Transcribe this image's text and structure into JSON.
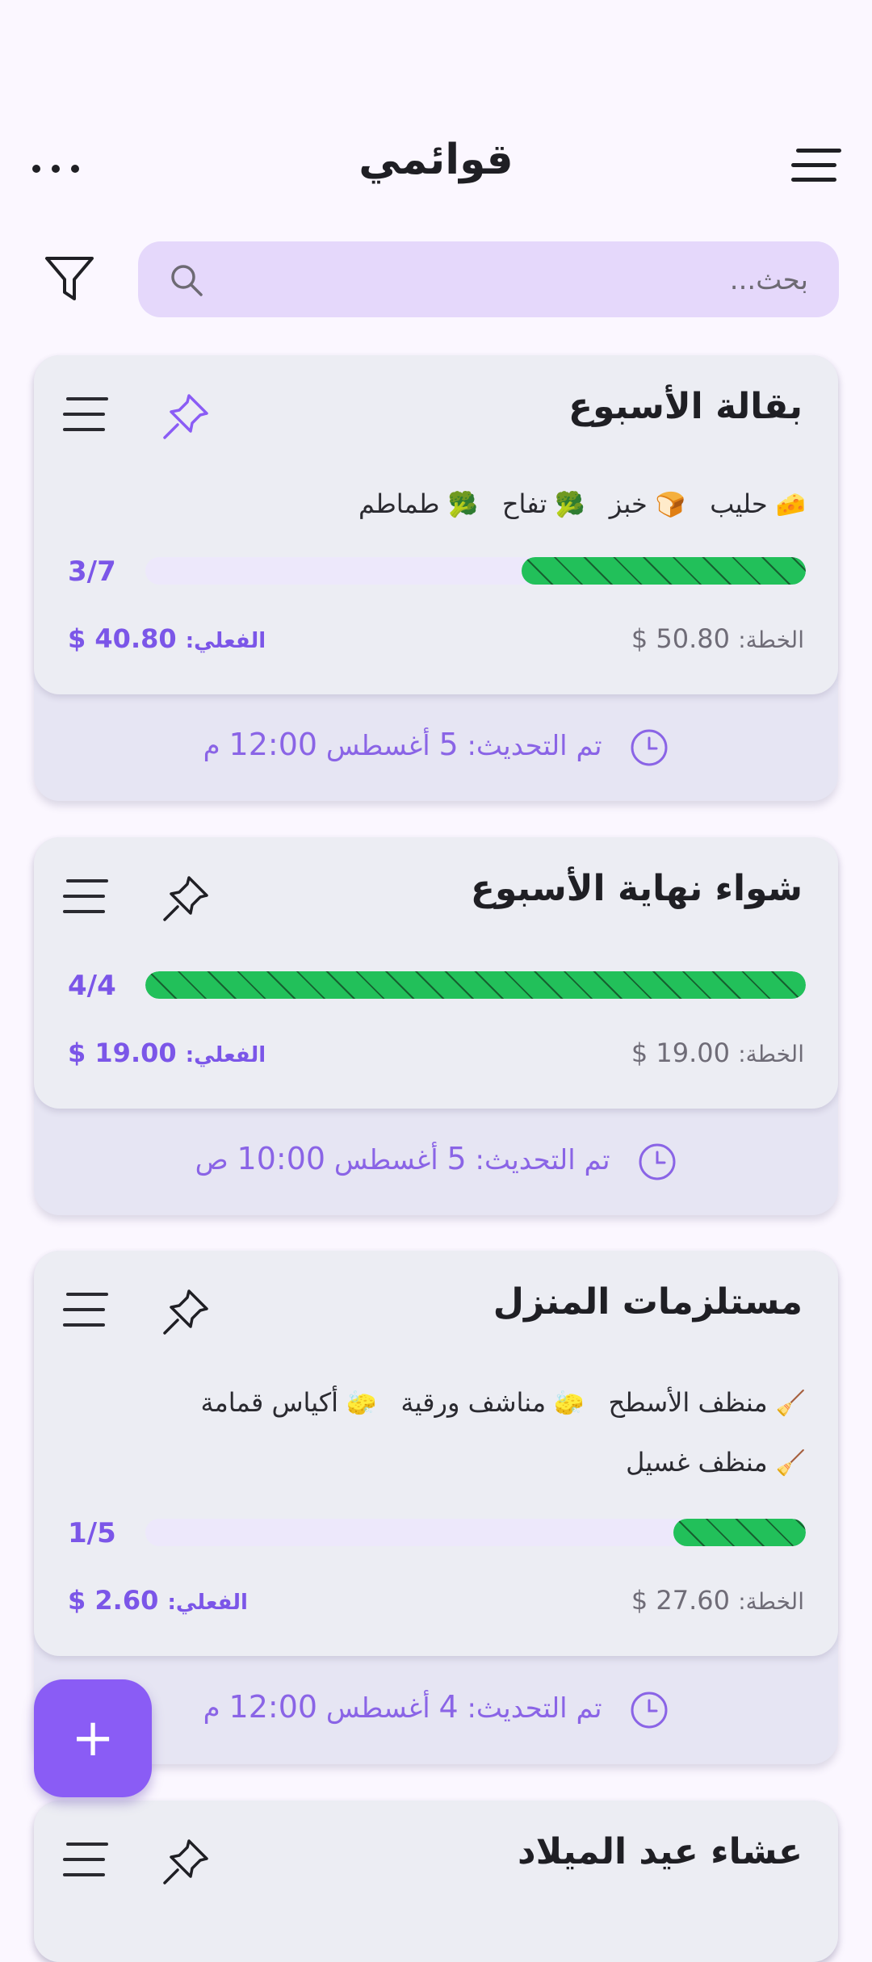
{
  "header": {
    "title": "قوائمي"
  },
  "search": {
    "placeholder": "بحث..."
  },
  "lists": [
    {
      "title": "بقالة الأسبوع",
      "pinned": true,
      "items": [
        {
          "emoji": "🧀",
          "label": "حليب"
        },
        {
          "emoji": "🍞",
          "label": "خبز"
        },
        {
          "emoji": "🥦",
          "label": "تفاح"
        },
        {
          "emoji": "🥦",
          "label": "طماطم"
        }
      ],
      "progress_text": "3/7",
      "progress": 0.43,
      "plan_label": "الخطة:",
      "plan_value": "50.80 $",
      "actual_label": "الفعلي:",
      "actual_value": "40.80 $",
      "updated_label": "تم التحديث:",
      "updated_day": "5",
      "updated_month": "أغسطس",
      "updated_time": "12:00",
      "updated_period": "م"
    },
    {
      "title": "شواء نهاية الأسبوع",
      "pinned": false,
      "items": [],
      "progress_text": "4/4",
      "progress": 1.0,
      "plan_label": "الخطة:",
      "plan_value": "19.00 $",
      "actual_label": "الفعلي:",
      "actual_value": "19.00 $",
      "updated_label": "تم التحديث:",
      "updated_day": "5",
      "updated_month": "أغسطس",
      "updated_time": "10:00",
      "updated_period": "ص"
    },
    {
      "title": "مستلزمات المنزل",
      "pinned": false,
      "items_row1": [
        {
          "emoji": "🧹",
          "label": "منظف الأسطح"
        },
        {
          "emoji": "🧽",
          "label": "مناشف ورقية"
        },
        {
          "emoji": "🧽",
          "label": "أكياس قمامة"
        }
      ],
      "items_row2": [
        {
          "emoji": "🧹",
          "label": "منظف غسيل"
        }
      ],
      "progress_text": "1/5",
      "progress": 0.2,
      "plan_label": "الخطة:",
      "plan_value": "27.60 $",
      "actual_label": "الفعلي:",
      "actual_value": "2.60 $",
      "updated_label": "تم التحديث:",
      "updated_day": "4",
      "updated_month": "أغسطس",
      "updated_time": "12:00",
      "updated_period": "م"
    },
    {
      "title": "عشاء عيد الميلاد",
      "pinned": false
    }
  ],
  "fab": {
    "label": "+"
  },
  "colors": {
    "accent": "#8A5CF5",
    "progress_green": "#22C05A",
    "search_bg": "#E5D8FB"
  }
}
